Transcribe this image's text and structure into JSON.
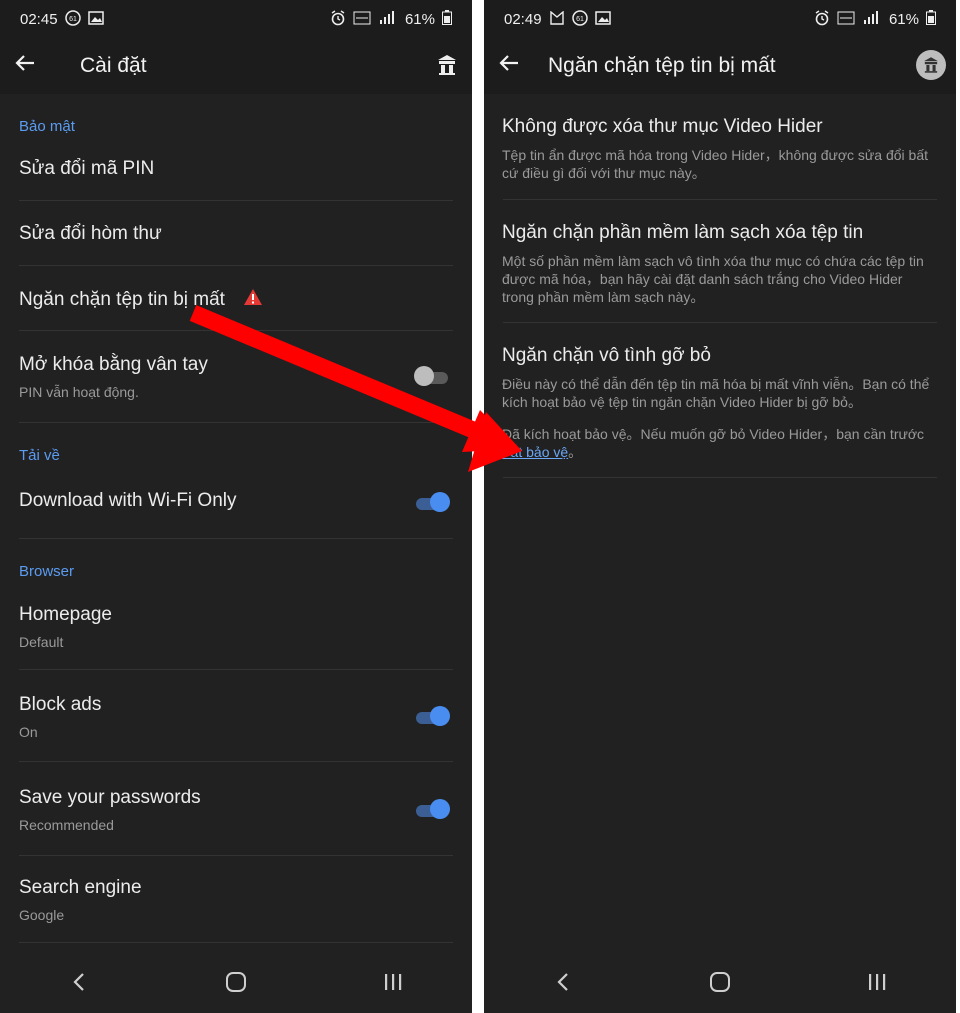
{
  "left": {
    "status": {
      "time": "02:45",
      "badge": "61",
      "battery": "61%"
    },
    "appbar": {
      "title": "Cài đặt",
      "action_icon": "hider-app-icon"
    },
    "sections": [
      {
        "header": "Bảo mật",
        "items": [
          {
            "title": "Sửa đổi mã PIN"
          },
          {
            "title": "Sửa đổi hòm thư"
          },
          {
            "title": "Ngăn chặn tệp tin bị mất",
            "warning": true
          },
          {
            "title": "Mở khóa bằng vân tay",
            "sub": "PIN vẫn hoạt động.",
            "toggle": "off"
          }
        ]
      },
      {
        "header": "Tải về",
        "items": [
          {
            "title": "Download with Wi-Fi Only",
            "toggle": "on"
          }
        ]
      },
      {
        "header": "Browser",
        "items": [
          {
            "title": "Homepage",
            "sub": "Default"
          },
          {
            "title": "Block ads",
            "sub": "On",
            "toggle": "on"
          },
          {
            "title": "Save your passwords",
            "sub": "Recommended",
            "toggle": "on"
          },
          {
            "title": "Search engine",
            "sub": "Google"
          }
        ]
      }
    ]
  },
  "right": {
    "status": {
      "time": "02:49",
      "badge": "61",
      "battery": "61%"
    },
    "appbar": {
      "title": "Ngăn chặn tệp tin bị mất"
    },
    "items": [
      {
        "title": "Không được xóa thư mục Video Hider",
        "desc": "Tệp tin ẩn được mã hóa trong Video Hider，không được sửa đổi bất cứ điều gì đối với thư mục này。"
      },
      {
        "title": "Ngăn chặn phần mềm làm sạch xóa tệp tin",
        "desc": "Một số phần mềm làm sạch vô tình xóa thư mục có chứa các tệp tin được mã hóa，bạn hãy cài đặt danh sách trắng cho Video Hider trong phần mềm làm sạch này。"
      },
      {
        "title": "Ngăn chặn vô tình gỡ bỏ",
        "desc": "Điều này có thể dẫn đến tệp tin mã hóa bị mất vĩnh viễn。Bạn có thể kích hoạt bảo vệ tệp tin ngăn chặn Video Hider bị gỡ bỏ。",
        "desc2_prefix": "Đã kích hoạt bảo vệ。Nếu muốn gỡ bỏ Video Hider，bạn cần trước",
        "link": "Tắt bảo vệ",
        "desc2_suffix": "。"
      }
    ]
  },
  "colors": {
    "background": "#212121",
    "accent": "#4a8df0",
    "section_header": "#5b9cf1",
    "warning": "#e53935",
    "annotation_arrow": "#ff0000"
  },
  "annotation": {
    "type": "arrow",
    "from": "left.sections.0.items.2",
    "to": "right.items.2"
  }
}
